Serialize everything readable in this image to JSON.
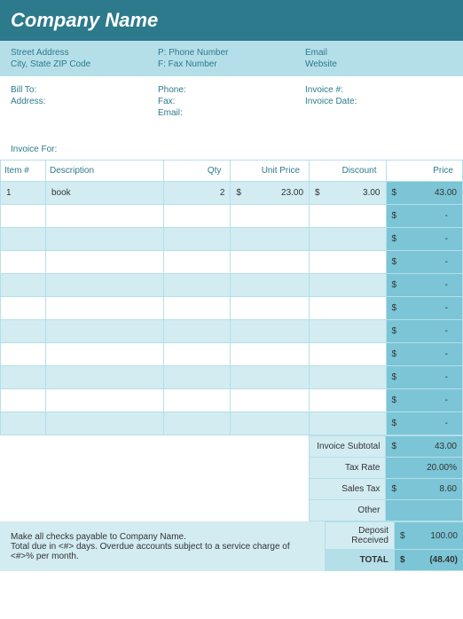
{
  "header": {
    "company": "Company Name"
  },
  "contact": {
    "street": "Street Address",
    "city": "City, State ZIP Code",
    "phone": "P: Phone Number",
    "fax": "F: Fax Number",
    "email": "Email",
    "website": "Website"
  },
  "billto": {
    "billto_label": "Bill To:",
    "address_label": "Address:",
    "phone_label": "Phone:",
    "fax_label": "Fax:",
    "email_label": "Email:",
    "invoice_num_label": "Invoice #:",
    "invoice_date_label": "Invoice Date:"
  },
  "invoice_for_label": "Invoice For:",
  "columns": {
    "item": "Item #",
    "desc": "Description",
    "qty": "Qty",
    "unit": "Unit Price",
    "disc": "Discount",
    "price": "Price"
  },
  "rows": [
    {
      "item": "1",
      "desc": "book",
      "qty": "2",
      "unit": "23.00",
      "disc": "3.00",
      "price": "43.00"
    },
    {
      "item": "",
      "desc": "",
      "qty": "",
      "unit": "",
      "disc": "",
      "price": "-"
    },
    {
      "item": "",
      "desc": "",
      "qty": "",
      "unit": "",
      "disc": "",
      "price": "-"
    },
    {
      "item": "",
      "desc": "",
      "qty": "",
      "unit": "",
      "disc": "",
      "price": "-"
    },
    {
      "item": "",
      "desc": "",
      "qty": "",
      "unit": "",
      "disc": "",
      "price": "-"
    },
    {
      "item": "",
      "desc": "",
      "qty": "",
      "unit": "",
      "disc": "",
      "price": "-"
    },
    {
      "item": "",
      "desc": "",
      "qty": "",
      "unit": "",
      "disc": "",
      "price": "-"
    },
    {
      "item": "",
      "desc": "",
      "qty": "",
      "unit": "",
      "disc": "",
      "price": "-"
    },
    {
      "item": "",
      "desc": "",
      "qty": "",
      "unit": "",
      "disc": "",
      "price": "-"
    },
    {
      "item": "",
      "desc": "",
      "qty": "",
      "unit": "",
      "disc": "",
      "price": "-"
    },
    {
      "item": "",
      "desc": "",
      "qty": "",
      "unit": "",
      "disc": "",
      "price": "-"
    }
  ],
  "totals": {
    "subtotal_label": "Invoice Subtotal",
    "subtotal": "43.00",
    "taxrate_label": "Tax Rate",
    "taxrate": "20.00%",
    "salestax_label": "Sales Tax",
    "salestax": "8.60",
    "other_label": "Other",
    "other": "",
    "deposit_label": "Deposit Received",
    "deposit": "100.00",
    "total_label": "TOTAL",
    "total": "(48.40)"
  },
  "footer": {
    "line1": "Make all checks payable to Company Name.",
    "line2": "Total due in <#> days. Overdue accounts subject to a service charge of <#>% per month."
  },
  "currency": "$"
}
